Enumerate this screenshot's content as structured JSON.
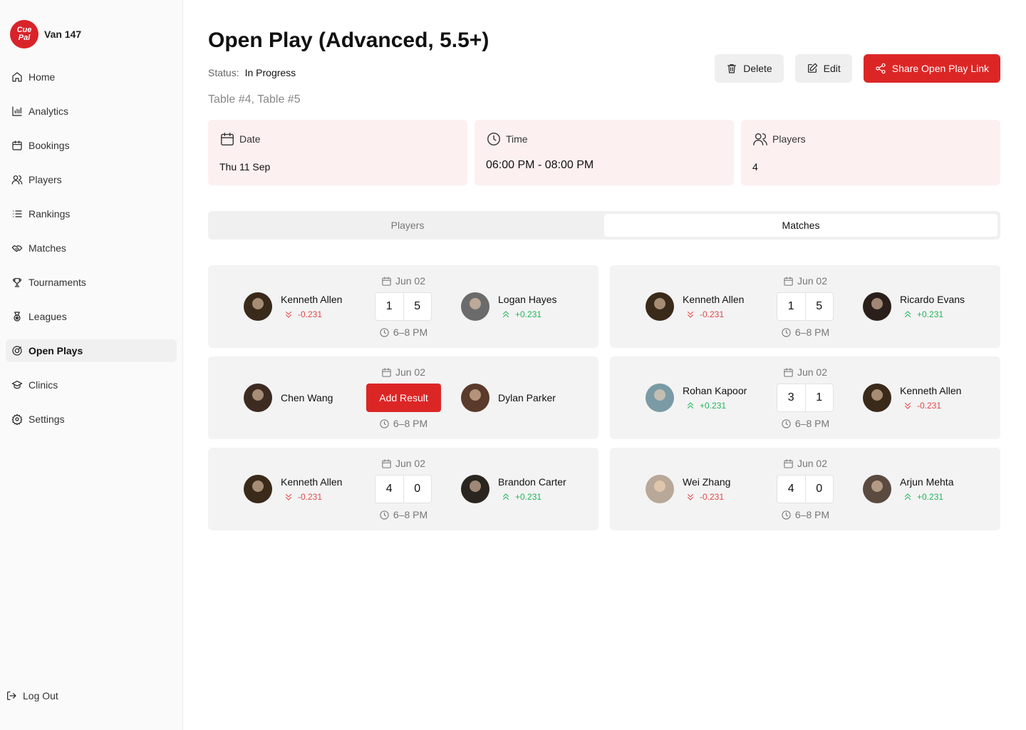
{
  "brand": {
    "logo_line1": "Cue",
    "logo_line2": "Pal",
    "name": "Van 147",
    "accent": "#d9232a"
  },
  "sidebar": {
    "items": [
      {
        "label": "Home",
        "icon": "home-icon"
      },
      {
        "label": "Analytics",
        "icon": "chart-icon"
      },
      {
        "label": "Bookings",
        "icon": "calendar-icon"
      },
      {
        "label": "Players",
        "icon": "users-icon"
      },
      {
        "label": "Rankings",
        "icon": "list-icon"
      },
      {
        "label": "Matches",
        "icon": "handshake-icon"
      },
      {
        "label": "Tournaments",
        "icon": "trophy-icon"
      },
      {
        "label": "Leagues",
        "icon": "medal-icon"
      },
      {
        "label": "Open Plays",
        "icon": "target-icon"
      },
      {
        "label": "Clinics",
        "icon": "graduation-icon"
      },
      {
        "label": "Settings",
        "icon": "gear-icon"
      }
    ],
    "active": "Open Plays",
    "logout": "Log Out"
  },
  "header": {
    "title": "Open Play (Advanced, 5.5+)",
    "status_label": "Status:",
    "status_value": "In Progress",
    "tables": "Table #4, Table #5",
    "delete_label": "Delete",
    "edit_label": "Edit",
    "share_label": "Share Open Play Link"
  },
  "info": {
    "date_label": "Date",
    "date_value": "Thu 11 Sep",
    "time_label": "Time",
    "time_value": "06:00 PM - 08:00 PM",
    "players_label": "Players",
    "players_value": "4"
  },
  "tabs": {
    "players": "Players",
    "matches": "Matches",
    "active": "matches"
  },
  "add_result_label": "Add Result",
  "matches": [
    {
      "date": "Jun 02",
      "time": "6–8 PM",
      "p1": {
        "name": "Kenneth Allen",
        "rating": "-0.231",
        "dir": "down",
        "color": "#3a2a1a"
      },
      "p2": {
        "name": "Logan Hayes",
        "rating": "+0.231",
        "dir": "up",
        "color": "#6b6b6b"
      },
      "s1": "1",
      "s2": "5"
    },
    {
      "date": "Jun 02",
      "time": "6–8 PM",
      "p1": {
        "name": "Kenneth Allen",
        "rating": "-0.231",
        "dir": "down",
        "color": "#3a2a1a"
      },
      "p2": {
        "name": "Ricardo Evans",
        "rating": "+0.231",
        "dir": "up",
        "color": "#2a1f1a"
      },
      "s1": "1",
      "s2": "5"
    },
    {
      "date": "Jun 02",
      "time": "6–8 PM",
      "p1": {
        "name": "Chen Wang",
        "rating": "",
        "dir": "",
        "color": "#3d2b22"
      },
      "p2": {
        "name": "Dylan Parker",
        "rating": "",
        "dir": "",
        "color": "#5a3a2a"
      },
      "s1": "",
      "s2": ""
    },
    {
      "date": "Jun 02",
      "time": "6–8 PM",
      "p1": {
        "name": "Rohan Kapoor",
        "rating": "+0.231",
        "dir": "up",
        "color": "#7a9aa5"
      },
      "p2": {
        "name": "Kenneth Allen",
        "rating": "-0.231",
        "dir": "down",
        "color": "#3a2a1a"
      },
      "s1": "3",
      "s2": "1"
    },
    {
      "date": "Jun 02",
      "time": "6–8 PM",
      "p1": {
        "name": "Kenneth Allen",
        "rating": "-0.231",
        "dir": "down",
        "color": "#3a2a1a"
      },
      "p2": {
        "name": "Brandon Carter",
        "rating": "+0.231",
        "dir": "up",
        "color": "#2b2520"
      },
      "s1": "4",
      "s2": "0"
    },
    {
      "date": "Jun 02",
      "time": "6–8 PM",
      "p1": {
        "name": "Wei Zhang",
        "rating": "-0.231",
        "dir": "down",
        "color": "#b8a898"
      },
      "p2": {
        "name": "Arjun Mehta",
        "rating": "+0.231",
        "dir": "up",
        "color": "#5a4a40"
      },
      "s1": "4",
      "s2": "0"
    }
  ]
}
